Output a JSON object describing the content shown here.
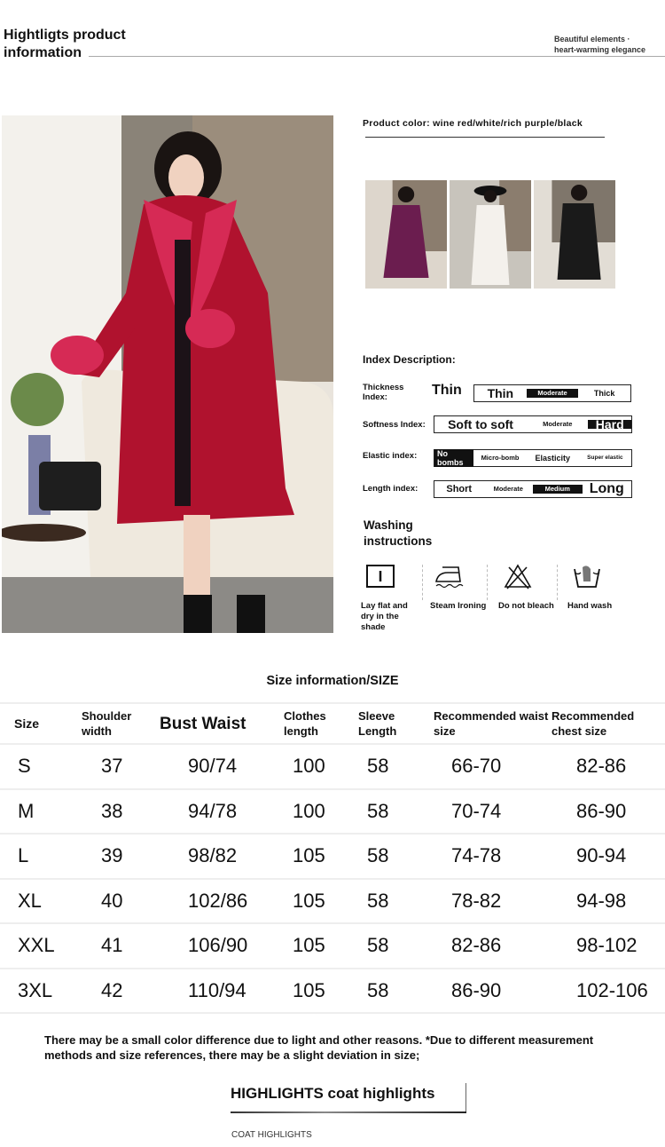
{
  "header": {
    "title_line1": "Hightligts product",
    "title_line2": "information",
    "subtitle_line1": "Beautiful elements ·",
    "subtitle_line2": "heart-warming elegance"
  },
  "product": {
    "color_label": "Product color: wine red/white/rich purple/black",
    "colors": [
      {
        "name": "wine red",
        "hex": "#b0122e"
      },
      {
        "name": "rich purple",
        "hex": "#6b1d4f"
      },
      {
        "name": "white",
        "hex": "#f4f1ec"
      },
      {
        "name": "black",
        "hex": "#1a1a1a"
      }
    ]
  },
  "index": {
    "title": "Index Description:",
    "rows": [
      {
        "label": "Thickness Index:",
        "lead": "Thin",
        "cells": [
          "Thin",
          "Moderate",
          "Thick"
        ],
        "selected": 1
      },
      {
        "label": "Softness Index:",
        "cells": [
          "Soft to soft",
          "Moderate",
          "Hard"
        ],
        "selected": 2
      },
      {
        "label": "Elastic index:",
        "cells": [
          "No bombs",
          "Micro-bomb",
          "Elasticity",
          "Super elastic"
        ],
        "selected": 0
      },
      {
        "label": "Length index:",
        "cells": [
          "Short",
          "Moderate",
          "Medium",
          "Long"
        ],
        "selected": 2
      }
    ]
  },
  "washing": {
    "title_line1": "Washing",
    "title_line2": "instructions",
    "items": [
      {
        "icon": "lay-flat-dry-icon",
        "label": "Lay flat and dry in the shade"
      },
      {
        "icon": "steam-iron-icon",
        "label": "Steam Ironing"
      },
      {
        "icon": "do-not-bleach-icon",
        "label": "Do not bleach"
      },
      {
        "icon": "hand-wash-icon",
        "label": "Hand wash"
      }
    ]
  },
  "size": {
    "title": "Size information/SIZE",
    "headers": [
      "Size",
      "Shoulder width",
      "Bust Waist",
      "Clothes length",
      "Sleeve Length",
      "Recommended waist size",
      "Recommended chest size"
    ],
    "rows": [
      [
        "S",
        "37",
        "90/74",
        "100",
        "58",
        "66-70",
        "82-86"
      ],
      [
        "M",
        "38",
        "94/78",
        "100",
        "58",
        "70-74",
        "86-90"
      ],
      [
        "L",
        "39",
        "98/82",
        "105",
        "58",
        "74-78",
        "90-94"
      ],
      [
        "XL",
        "40",
        "102/86",
        "105",
        "58",
        "78-82",
        "94-98"
      ],
      [
        "XXL",
        "41",
        "106/90",
        "105",
        "58",
        "82-86",
        "98-102"
      ],
      [
        "3XL",
        "42",
        "110/94",
        "105",
        "58",
        "86-90",
        "102-106"
      ]
    ]
  },
  "note": "There may be a small color difference due to light and other reasons. *Due to different measurement methods and size references, there may be a slight deviation in size;",
  "highlights": {
    "title": "HIGHLIGHTS coat highlights",
    "subtitle": "COAT HIGHLIGHTS"
  }
}
